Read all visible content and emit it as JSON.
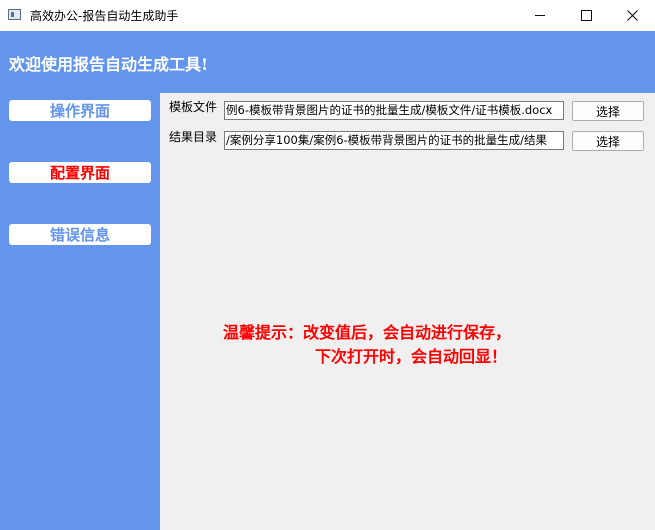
{
  "window": {
    "title": "高效办公-报告自动生成助手",
    "min_icon": "minimize-icon",
    "max_icon": "maximize-icon",
    "close_icon": "close-icon"
  },
  "header": {
    "welcome": "欢迎使用报告自动生成工具!"
  },
  "sidebar": {
    "items": [
      {
        "label": "操作界面",
        "color": "#6495ed"
      },
      {
        "label": "配置界面",
        "color": "#ff0000"
      },
      {
        "label": "错误信息",
        "color": "#6495ed"
      }
    ],
    "accent": "#6495ed"
  },
  "config": {
    "template_label": "模板文件",
    "template_value": "例6-模板带背景图片的证书的批量生成/模板文件/证书模板.docx",
    "template_button": "选择",
    "result_label": "结果目录",
    "result_value": "/案例分享100集/案例6-模板带背景图片的证书的批量生成/结果",
    "result_button": "选择"
  },
  "tip": {
    "line1": "温馨提示：改变值后，会自动进行保存，",
    "line2": "下次打开时，会自动回显！",
    "color": "#ff0000"
  }
}
